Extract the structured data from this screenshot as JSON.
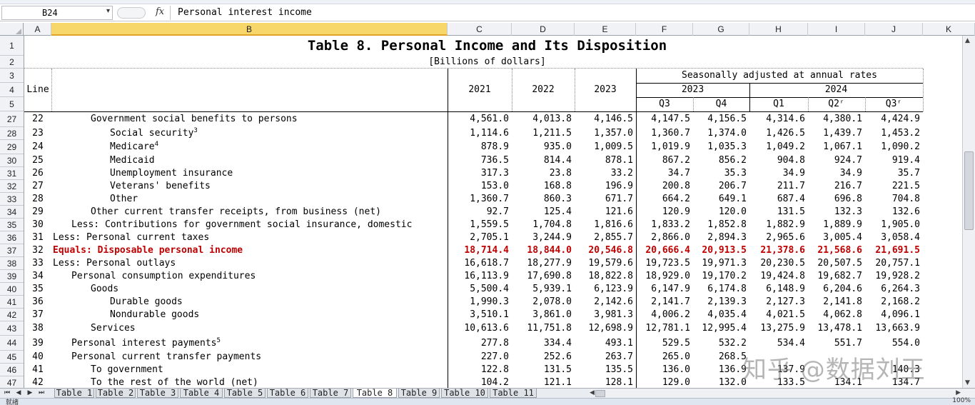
{
  "formula_bar": {
    "cell_ref": "B24",
    "fx_label": "fx",
    "content": "Personal interest income"
  },
  "columns": [
    "A",
    "B",
    "C",
    "D",
    "E",
    "F",
    "G",
    "H",
    "I",
    "J",
    "K"
  ],
  "selected_column": "B",
  "table": {
    "title": "Table 8. Personal Income and Its Disposition",
    "subtitle": "[Billions of dollars]",
    "line_header": "Line",
    "seasonal_header": "Seasonally adjusted at annual rates",
    "years": [
      "2021",
      "2022",
      "2023"
    ],
    "year_groups": [
      "2023",
      "2024"
    ],
    "quarters": [
      "Q3",
      "Q4",
      "Q1",
      "Q2ʳ",
      "Q3ʳ"
    ]
  },
  "header_rows": [
    "1",
    "2",
    "3",
    "4",
    "5"
  ],
  "rows": [
    {
      "row": "27",
      "line": "22",
      "label": "Government social benefits to persons",
      "indent": 2,
      "sup": "",
      "values": [
        "4,561.0",
        "4,013.8",
        "4,146.5",
        "4,147.5",
        "4,156.5",
        "4,314.6",
        "4,380.1",
        "4,424.9"
      ]
    },
    {
      "row": "28",
      "line": "23",
      "label": "Social security",
      "indent": 3,
      "sup": "3",
      "values": [
        "1,114.6",
        "1,211.5",
        "1,357.0",
        "1,360.7",
        "1,374.0",
        "1,426.5",
        "1,439.7",
        "1,453.2"
      ]
    },
    {
      "row": "29",
      "line": "24",
      "label": "Medicare",
      "indent": 3,
      "sup": "4",
      "values": [
        "878.9",
        "935.0",
        "1,009.5",
        "1,019.9",
        "1,035.3",
        "1,049.2",
        "1,067.1",
        "1,090.2"
      ]
    },
    {
      "row": "30",
      "line": "25",
      "label": "Medicaid",
      "indent": 3,
      "sup": "",
      "values": [
        "736.5",
        "814.4",
        "878.1",
        "867.2",
        "856.2",
        "904.8",
        "924.7",
        "919.4"
      ]
    },
    {
      "row": "31",
      "line": "26",
      "label": "Unemployment insurance",
      "indent": 3,
      "sup": "",
      "values": [
        "317.3",
        "23.8",
        "33.2",
        "34.7",
        "35.3",
        "34.9",
        "34.9",
        "35.7"
      ]
    },
    {
      "row": "32",
      "line": "27",
      "label": "Veterans' benefits",
      "indent": 3,
      "sup": "",
      "values": [
        "153.0",
        "168.8",
        "196.9",
        "200.8",
        "206.7",
        "211.7",
        "216.7",
        "221.5"
      ]
    },
    {
      "row": "33",
      "line": "28",
      "label": "Other",
      "indent": 3,
      "sup": "",
      "values": [
        "1,360.7",
        "860.3",
        "671.7",
        "664.2",
        "649.1",
        "687.4",
        "696.8",
        "704.8"
      ]
    },
    {
      "row": "34",
      "line": "29",
      "label": "Other current transfer receipts, from business (net)",
      "indent": 2,
      "sup": "",
      "values": [
        "92.7",
        "125.4",
        "121.6",
        "120.9",
        "120.0",
        "131.5",
        "132.3",
        "132.6"
      ]
    },
    {
      "row": "35",
      "line": "30",
      "label": "Less: Contributions for government social insurance, domestic",
      "indent": 1,
      "sup": "",
      "values": [
        "1,559.5",
        "1,704.8",
        "1,816.6",
        "1,833.2",
        "1,852.8",
        "1,882.9",
        "1,889.9",
        "1,905.0"
      ]
    },
    {
      "row": "36",
      "line": "31",
      "label": "Less: Personal current taxes",
      "indent": 0,
      "sup": "",
      "values": [
        "2,705.1",
        "3,244.9",
        "2,855.7",
        "2,866.0",
        "2,894.3",
        "2,965.6",
        "3,005.4",
        "3,058.4"
      ]
    },
    {
      "row": "37",
      "line": "32",
      "label": "Equals: Disposable personal income",
      "indent": 0,
      "sup": "",
      "emphasis": true,
      "values": [
        "18,714.4",
        "18,844.0",
        "20,546.8",
        "20,666.4",
        "20,913.5",
        "21,378.6",
        "21,568.6",
        "21,691.5"
      ]
    },
    {
      "row": "38",
      "line": "33",
      "label": "Less: Personal outlays",
      "indent": 0,
      "sup": "",
      "values": [
        "16,618.7",
        "18,277.9",
        "19,579.6",
        "19,723.5",
        "19,971.3",
        "20,230.5",
        "20,507.5",
        "20,757.1"
      ]
    },
    {
      "row": "39",
      "line": "34",
      "label": "Personal consumption expenditures",
      "indent": 1,
      "sup": "",
      "values": [
        "16,113.9",
        "17,690.8",
        "18,822.8",
        "18,929.0",
        "19,170.2",
        "19,424.8",
        "19,682.7",
        "19,928.2"
      ]
    },
    {
      "row": "40",
      "line": "35",
      "label": "Goods",
      "indent": 2,
      "sup": "",
      "values": [
        "5,500.4",
        "5,939.1",
        "6,123.9",
        "6,147.9",
        "6,174.8",
        "6,148.9",
        "6,204.6",
        "6,264.3"
      ]
    },
    {
      "row": "41",
      "line": "36",
      "label": "Durable goods",
      "indent": 3,
      "sup": "",
      "values": [
        "1,990.3",
        "2,078.0",
        "2,142.6",
        "2,141.7",
        "2,139.3",
        "2,127.3",
        "2,141.8",
        "2,168.2"
      ]
    },
    {
      "row": "42",
      "line": "37",
      "label": "Nondurable goods",
      "indent": 3,
      "sup": "",
      "values": [
        "3,510.1",
        "3,861.0",
        "3,981.3",
        "4,006.2",
        "4,035.4",
        "4,021.5",
        "4,062.8",
        "4,096.1"
      ]
    },
    {
      "row": "43",
      "line": "38",
      "label": "Services",
      "indent": 2,
      "sup": "",
      "values": [
        "10,613.6",
        "11,751.8",
        "12,698.9",
        "12,781.1",
        "12,995.4",
        "13,275.9",
        "13,478.1",
        "13,663.9"
      ]
    },
    {
      "row": "44",
      "line": "39",
      "label": "Personal interest payments",
      "indent": 1,
      "sup": "5",
      "values": [
        "277.8",
        "334.4",
        "493.1",
        "529.5",
        "532.2",
        "534.4",
        "551.7",
        "554.0"
      ]
    },
    {
      "row": "45",
      "line": "40",
      "label": "Personal current transfer payments",
      "indent": 1,
      "sup": "",
      "values": [
        "227.0",
        "252.6",
        "263.7",
        "265.0",
        "268.5",
        "",
        "",
        ""
      ]
    },
    {
      "row": "46",
      "line": "41",
      "label": "To government",
      "indent": 2,
      "sup": "",
      "values": [
        "122.8",
        "131.5",
        "135.5",
        "136.0",
        "136.9",
        "137.9",
        "",
        "140.3"
      ]
    },
    {
      "row": "47",
      "line": "42",
      "label": "To the rest of the world (net)",
      "indent": 2,
      "sup": "",
      "values": [
        "104.2",
        "121.1",
        "128.1",
        "129.0",
        "132.0",
        "133.5",
        "134.1",
        "134.7"
      ]
    }
  ],
  "sheet_tabs": [
    "Table 1",
    "Table 2",
    "Table 3",
    "Table 4",
    "Table 5",
    "Table 6",
    "Table 7",
    "Table 8",
    "Table 9",
    "Table 10",
    "Table 11"
  ],
  "active_tab": "Table 8",
  "status": {
    "left": "就绪",
    "zoom": "100%"
  },
  "watermark": "知乎 @数据刘王",
  "colors": {
    "accent_red": "#c00000",
    "selected_header": "#f7d76a"
  }
}
